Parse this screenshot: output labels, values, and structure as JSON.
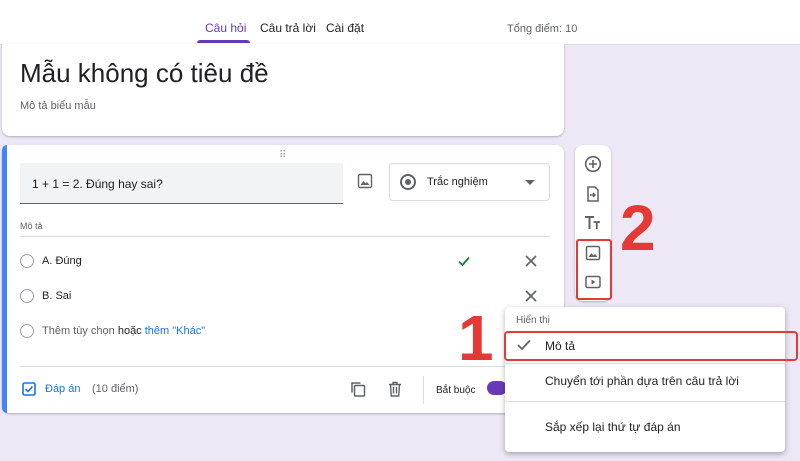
{
  "header": {
    "tabs": [
      {
        "label": "Câu hỏi",
        "active": true
      },
      {
        "label": "Câu trả lời",
        "active": false
      },
      {
        "label": "Cài đặt",
        "active": false
      }
    ],
    "total_points": "Tổng điểm: 10"
  },
  "form": {
    "title": "Mẫu không có tiêu đề",
    "description_placeholder": "Mô tả biểu mẫu"
  },
  "question": {
    "text": "1 + 1 = 2. Đúng hay sai?",
    "type": "Trắc nghiệm",
    "description_label": "Mô tả",
    "options": [
      {
        "label": "A. Đúng",
        "correct": true
      },
      {
        "label": "B. Sai",
        "correct": false
      }
    ],
    "add_option": "Thêm tùy chọn",
    "add_or": "hoặc",
    "add_other": "thêm \"Khác\"",
    "answer_key": "Đáp án",
    "points": "(10 điểm)",
    "required_label": "Bắt buộc",
    "required": true
  },
  "toolbar": {
    "icons": [
      "add-question-icon",
      "import-question-icon",
      "add-title-icon",
      "add-image-icon",
      "add-video-icon"
    ]
  },
  "annotations": {
    "label_1": "1",
    "label_2": "2"
  },
  "menu": {
    "header": "Hiển thị",
    "items": [
      {
        "label": "Mô tả",
        "checked": true
      },
      {
        "label": "Chuyển tới phần dựa trên câu trả lời",
        "checked": false
      },
      {
        "label": "Sắp xếp lại thứ tự đáp án",
        "checked": false
      }
    ]
  },
  "colors": {
    "accent": "#673ab7",
    "background": "#ede7f6",
    "link": "#1a73e8",
    "annotation": "#e53935",
    "correct": "#188038"
  }
}
